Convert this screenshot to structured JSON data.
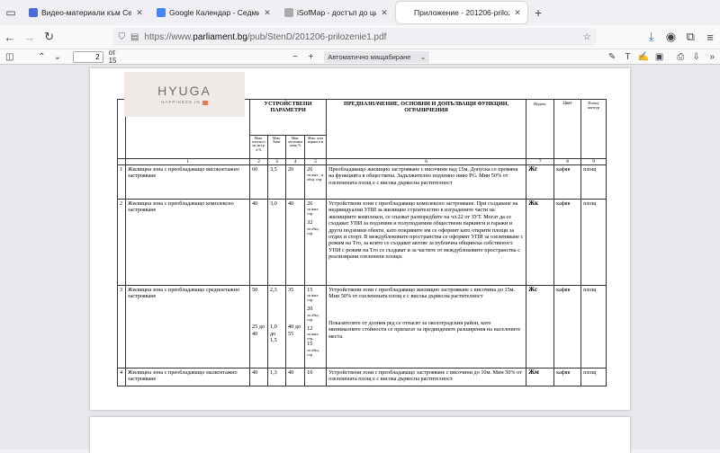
{
  "tabs": [
    {
      "title": "Видео-материали към Серти",
      "active": false,
      "color": "#4a6bd8"
    },
    {
      "title": "Google Календар - Седмицата",
      "active": false,
      "color": "#4285f4"
    },
    {
      "title": "iSofMap - достъп до цифрови данни",
      "active": false,
      "color": "#aaaaaa"
    },
    {
      "title": "Приложение - 201206-prilozenie1",
      "active": true,
      "color": "#ffffff"
    }
  ],
  "url": {
    "prefix": "https://www.",
    "domain": "parliament.bg",
    "path": "/pub/StenD/201206-prilozenie1.pdf"
  },
  "pdf": {
    "page": "2",
    "of": "от 15",
    "zoom": "Автоматично мащабиране"
  },
  "logo": {
    "text": "HYUGA",
    "sub": "HAPPINESS IN"
  },
  "table": {
    "h_params": "УСТРОЙСТВЕНИ ПАРАМЕТРИ",
    "h_purpose": "ПРЕДНАЗНАЧЕНИЕ, ОСНОВНИ И ДОПЪЛВАЩИ ФУНКЦИИ, ОГРАНИЧЕНИЯ",
    "h_index": "Индекс",
    "h_color": "Цвят",
    "h_fill": "Площ/ контур",
    "sub1": "Макс. плътност на застр. в %",
    "sub2": "Макс. Кинт",
    "sub3": "Мин. озеленена площ %",
    "sub4": "Макс. кота корниз в м",
    "nums": [
      "1",
      "2",
      "3",
      "4",
      "5",
      "6",
      "7",
      "8",
      "9"
    ],
    "rows": [
      {
        "n": "1",
        "zone": "Жилищна зона с преобладаващо високоетажно застрояване",
        "p1": "60",
        "p2": "3,5",
        "p3": "20",
        "p4a": "26",
        "p4b": "за жил., и общ. стр.",
        "text": "Преобладаващо жилищно застрояване с височини над 15м. Допуска се промяна на функцията в обществена. Задължително подземно ниво РG. Мин 50% от озеленената площ е с висока дървесна растителност",
        "idx": "Жг",
        "color": "кафяв",
        "fill": "площ"
      },
      {
        "n": "2",
        "zone": "Жилищна зона с преобладаващо комплексно застрояване",
        "p1": "40",
        "p2": "3,0",
        "p3": "40",
        "p4a": "26",
        "p4b": "за жил. стр.",
        "p4c": "32",
        "p4d": "за общ. стр.",
        "text": "Устройствени зони с преобладаващо комплексно застрояване. При създаване на индивидуални УПИ за жилищно строителство в изградените части на жилищните комплекси, се спазват разпоредбите на чл.22 от ЗУТ. Могат да се създават УПИ за подземни и полуподземни обществени паркинги и гаражи и други подземни обекти, като покривите им се оформят като открити площи за отдих и спорт. В междублоковите пространства се оформят УПИ за озеленяване с режим на Тго, за които се създават актове за публична общинска собственост. УПИ с режим на Тго се създават и за частите от междублоковите пространства с реализирани озеленени площи.",
        "idx": "Жк",
        "color": "кафяв",
        "fill": "площ"
      },
      {
        "n": "3",
        "zone": "Жилищна зона с преобладаващо средноетажно застрояване",
        "p1": "50",
        "p1b": "25 до 40",
        "p2": "2,3",
        "p2b": "1,0 до 1,5",
        "p3": "35",
        "p3b": "40 до 55",
        "p4a": "15",
        "p4b": "за жил. стр.",
        "p4c": "20",
        "p4d": "за общ. стр.",
        "p4e": "12",
        "p4f": "за жил. стр.",
        "p4g": "15",
        "p4h": "за общ. стр.",
        "text": "Устройствени зони с преобладаващо жилищно застрояване с височина до 15м. Мин 50% от озеленената площ е с висока дървесна растителност",
        "text2": "Показателите от долния ред се отнасят за околоградския район, като минималните стойности се прилагат за предвидените разширения на населените места.",
        "idx": "Жс",
        "color": "кафяв",
        "fill": "площ"
      },
      {
        "n": "4",
        "zone": "Жилищна зона с преобладаващо малкоетажно застрояване",
        "p1": "40",
        "p2": "1,3",
        "p3": "40",
        "p4a": "10",
        "text": "Устройствени зони с преобладаващо застрояване с височини до 10м. Мин 50% от озеленената площ е с висока дървесна растителност.",
        "idx": "Жм",
        "color": "кафяв",
        "fill": "площ"
      }
    ]
  }
}
